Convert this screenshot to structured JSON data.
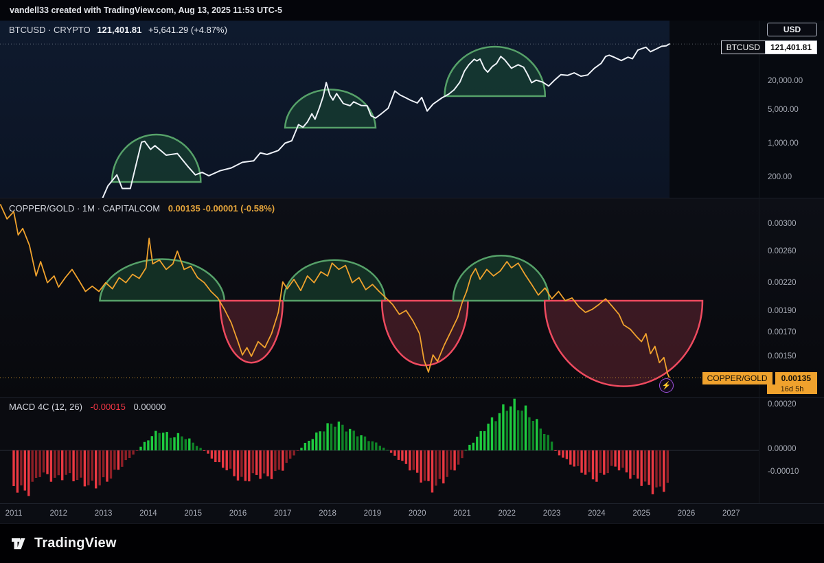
{
  "watermark": "vandell33 created with TradingView.com, Aug 13, 2025 11:53 UTC-5",
  "icons": {
    "lightning": "⚡"
  },
  "colors": {
    "accent_orange": "#f0a22d",
    "white_line": "#eef2f8",
    "dome_fill": "rgba(28,82,53,0.5)",
    "dome_stroke": "#56a169",
    "bowl_fill": "rgba(193,62,84,0.27)",
    "bowl_stroke": "#ee4a5f",
    "dotted_level": "#b5832a",
    "macd_pos_bright": "#1ecb3f",
    "macd_pos_dim": "#0f8427",
    "macd_neg_bright": "#e93842",
    "macd_neg_dim": "#8c1f26"
  },
  "btc_pane": {
    "legend_symbol": "BTCUSD · CRYPTO",
    "legend_price": "121,401.81",
    "legend_change": "+5,641.29 (+4.87%)",
    "currency_button": "USD",
    "price_label_symbol": "BTCUSD",
    "price_label_value": "121,401.81",
    "ticks": [
      {
        "v": 20000,
        "label": "20,000.00"
      },
      {
        "v": 5000,
        "label": "5,000.00"
      },
      {
        "v": 1000,
        "label": "1,000.00"
      },
      {
        "v": 200,
        "label": "200.00"
      }
    ]
  },
  "copper_pane": {
    "legend_symbol": "COPPER/GOLD · 1M · CAPITALCOM",
    "legend_values": "0.00135 -0.00001 (-0.58%)",
    "price_label_symbol": "COPPER/GOLD",
    "price_label_value": "0.00135",
    "countdown": "16d 5h",
    "ticks": [
      {
        "v": 0.003,
        "label": "0.00300"
      },
      {
        "v": 0.0026,
        "label": "0.00260"
      },
      {
        "v": 0.0022,
        "label": "0.00220"
      },
      {
        "v": 0.0019,
        "label": "0.00190"
      },
      {
        "v": 0.0017,
        "label": "0.00170"
      },
      {
        "v": 0.0015,
        "label": "0.00150"
      }
    ]
  },
  "macd_pane": {
    "legend_title": "MACD 4C (12, 26)",
    "legend_value_1": "-0.00015",
    "legend_value_2": "0.00000",
    "ticks": [
      {
        "v": 0.0002,
        "label": "0.00020"
      },
      {
        "v": 0,
        "label": "0.00000"
      },
      {
        "v": -0.0001,
        "label": "-0.00010"
      }
    ]
  },
  "time_axis": {
    "years": [
      2011,
      2012,
      2013,
      2014,
      2015,
      2016,
      2017,
      2018,
      2019,
      2020,
      2021,
      2022,
      2023,
      2024,
      2025,
      2026,
      2027
    ]
  },
  "footer": {
    "brand": "TradingView"
  },
  "chart_data": [
    {
      "type": "line",
      "name": "BTCUSD",
      "yscale": "log",
      "x_unit": "decimal_year",
      "current": 121401.81,
      "right_axis_ticks": [
        20000,
        5000,
        1000,
        200
      ],
      "points": [
        [
          2012.98,
          75
        ],
        [
          2013.1,
          135
        ],
        [
          2013.3,
          230
        ],
        [
          2013.42,
          120
        ],
        [
          2013.6,
          120
        ],
        [
          2013.85,
          1100
        ],
        [
          2013.92,
          1150
        ],
        [
          2014.05,
          780
        ],
        [
          2014.15,
          930
        ],
        [
          2014.4,
          590
        ],
        [
          2014.65,
          640
        ],
        [
          2014.9,
          330
        ],
        [
          2015.05,
          230
        ],
        [
          2015.2,
          260
        ],
        [
          2015.35,
          220
        ],
        [
          2015.6,
          280
        ],
        [
          2015.85,
          320
        ],
        [
          2016.1,
          420
        ],
        [
          2016.35,
          450
        ],
        [
          2016.5,
          660
        ],
        [
          2016.65,
          610
        ],
        [
          2016.9,
          740
        ],
        [
          2017.05,
          1050
        ],
        [
          2017.2,
          1180
        ],
        [
          2017.35,
          2550
        ],
        [
          2017.45,
          2250
        ],
        [
          2017.55,
          2900
        ],
        [
          2017.65,
          4300
        ],
        [
          2017.72,
          3300
        ],
        [
          2017.82,
          5800
        ],
        [
          2017.9,
          9800
        ],
        [
          2017.97,
          19200
        ],
        [
          2018.05,
          10500
        ],
        [
          2018.12,
          8300
        ],
        [
          2018.2,
          11300
        ],
        [
          2018.35,
          7000
        ],
        [
          2018.5,
          6300
        ],
        [
          2018.58,
          7600
        ],
        [
          2018.75,
          6400
        ],
        [
          2018.88,
          6300
        ],
        [
          2018.97,
          3900
        ],
        [
          2019.07,
          3500
        ],
        [
          2019.17,
          4100
        ],
        [
          2019.35,
          5600
        ],
        [
          2019.5,
          12800
        ],
        [
          2019.62,
          10500
        ],
        [
          2019.72,
          9500
        ],
        [
          2019.85,
          8200
        ],
        [
          2020.0,
          7200
        ],
        [
          2020.1,
          9400
        ],
        [
          2020.22,
          4900
        ],
        [
          2020.35,
          6800
        ],
        [
          2020.55,
          9200
        ],
        [
          2020.7,
          11000
        ],
        [
          2020.82,
          13500
        ],
        [
          2020.95,
          19500
        ],
        [
          2021.05,
          33000
        ],
        [
          2021.15,
          45000
        ],
        [
          2021.27,
          58500
        ],
        [
          2021.33,
          54000
        ],
        [
          2021.4,
          59000
        ],
        [
          2021.5,
          37000
        ],
        [
          2021.57,
          31500
        ],
        [
          2021.67,
          41000
        ],
        [
          2021.77,
          48000
        ],
        [
          2021.86,
          66900
        ],
        [
          2021.95,
          57000
        ],
        [
          2022.1,
          38000
        ],
        [
          2022.25,
          45000
        ],
        [
          2022.37,
          40000
        ],
        [
          2022.45,
          29500
        ],
        [
          2022.55,
          19000
        ],
        [
          2022.65,
          21500
        ],
        [
          2022.8,
          19500
        ],
        [
          2022.93,
          16200
        ],
        [
          2023.05,
          21000
        ],
        [
          2023.2,
          28000
        ],
        [
          2023.35,
          27000
        ],
        [
          2023.5,
          30500
        ],
        [
          2023.65,
          26000
        ],
        [
          2023.8,
          27500
        ],
        [
          2023.95,
          38000
        ],
        [
          2024.1,
          48000
        ],
        [
          2024.2,
          67000
        ],
        [
          2024.28,
          71000
        ],
        [
          2024.4,
          64000
        ],
        [
          2024.55,
          55000
        ],
        [
          2024.7,
          64500
        ],
        [
          2024.8,
          60000
        ],
        [
          2024.92,
          91000
        ],
        [
          2025.0,
          97000
        ],
        [
          2025.1,
          104000
        ],
        [
          2025.2,
          84000
        ],
        [
          2025.32,
          95000
        ],
        [
          2025.45,
          109000
        ],
        [
          2025.55,
          111500
        ],
        [
          2025.62,
          121401
        ]
      ],
      "arcs": [
        {
          "kind": "dome",
          "center": 2014.18,
          "radius": 0.99,
          "base": 164,
          "extreme": 1585
        },
        {
          "kind": "dome",
          "center": 2018.06,
          "radius": 1.01,
          "base": 2200,
          "extreme": 14800
        },
        {
          "kind": "dome",
          "center": 2021.73,
          "radius": 1.12,
          "base": 10000,
          "extreme": 106800
        }
      ]
    },
    {
      "type": "line",
      "name": "COPPER/GOLD 1M",
      "yscale": "log",
      "x_unit": "decimal_year",
      "current": 0.00135,
      "right_axis_ticks": [
        0.003,
        0.0026,
        0.0022,
        0.0019,
        0.0017,
        0.0015
      ],
      "points": [
        [
          2010.7,
          0.00335
        ],
        [
          2010.85,
          0.0031
        ],
        [
          2011.0,
          0.00322
        ],
        [
          2011.1,
          0.00285
        ],
        [
          2011.2,
          0.00295
        ],
        [
          2011.35,
          0.0027
        ],
        [
          2011.5,
          0.0023
        ],
        [
          2011.6,
          0.00248
        ],
        [
          2011.75,
          0.00222
        ],
        [
          2011.9,
          0.0023
        ],
        [
          2012.0,
          0.00217
        ],
        [
          2012.15,
          0.00228
        ],
        [
          2012.3,
          0.00238
        ],
        [
          2012.45,
          0.00225
        ],
        [
          2012.6,
          0.00212
        ],
        [
          2012.75,
          0.00218
        ],
        [
          2012.9,
          0.00212
        ],
        [
          2013.05,
          0.00222
        ],
        [
          2013.2,
          0.00215
        ],
        [
          2013.35,
          0.00228
        ],
        [
          2013.5,
          0.00222
        ],
        [
          2013.65,
          0.00232
        ],
        [
          2013.8,
          0.00227
        ],
        [
          2013.95,
          0.0024
        ],
        [
          2014.02,
          0.0028
        ],
        [
          2014.1,
          0.00245
        ],
        [
          2014.25,
          0.0025
        ],
        [
          2014.4,
          0.00238
        ],
        [
          2014.55,
          0.00245
        ],
        [
          2014.65,
          0.00262
        ],
        [
          2014.8,
          0.00238
        ],
        [
          2014.95,
          0.00242
        ],
        [
          2015.1,
          0.00228
        ],
        [
          2015.25,
          0.00222
        ],
        [
          2015.4,
          0.00212
        ],
        [
          2015.55,
          0.00205
        ],
        [
          2015.7,
          0.00193
        ],
        [
          2015.85,
          0.0018
        ],
        [
          2016.0,
          0.00163
        ],
        [
          2016.1,
          0.00152
        ],
        [
          2016.2,
          0.00158
        ],
        [
          2016.3,
          0.00151
        ],
        [
          2016.45,
          0.00163
        ],
        [
          2016.6,
          0.00158
        ],
        [
          2016.75,
          0.0017
        ],
        [
          2016.9,
          0.0019
        ],
        [
          2017.0,
          0.00223
        ],
        [
          2017.1,
          0.00215
        ],
        [
          2017.25,
          0.00226
        ],
        [
          2017.4,
          0.00213
        ],
        [
          2017.55,
          0.0023
        ],
        [
          2017.7,
          0.00222
        ],
        [
          2017.85,
          0.00235
        ],
        [
          2018.0,
          0.0023
        ],
        [
          2018.1,
          0.00246
        ],
        [
          2018.25,
          0.00238
        ],
        [
          2018.4,
          0.00243
        ],
        [
          2018.55,
          0.00222
        ],
        [
          2018.7,
          0.00228
        ],
        [
          2018.85,
          0.00214
        ],
        [
          2019.0,
          0.0022
        ],
        [
          2019.15,
          0.00212
        ],
        [
          2019.3,
          0.00205
        ],
        [
          2019.45,
          0.00198
        ],
        [
          2019.6,
          0.00188
        ],
        [
          2019.75,
          0.00192
        ],
        [
          2019.9,
          0.00182
        ],
        [
          2020.05,
          0.0017
        ],
        [
          2020.15,
          0.00148
        ],
        [
          2020.25,
          0.00139
        ],
        [
          2020.35,
          0.00152
        ],
        [
          2020.45,
          0.00147
        ],
        [
          2020.6,
          0.0016
        ],
        [
          2020.75,
          0.00172
        ],
        [
          2020.9,
          0.00185
        ],
        [
          2021.0,
          0.002
        ],
        [
          2021.1,
          0.00212
        ],
        [
          2021.2,
          0.0023
        ],
        [
          2021.3,
          0.00239
        ],
        [
          2021.4,
          0.00226
        ],
        [
          2021.55,
          0.00238
        ],
        [
          2021.7,
          0.0023
        ],
        [
          2021.85,
          0.00236
        ],
        [
          2022.0,
          0.00248
        ],
        [
          2022.1,
          0.0024
        ],
        [
          2022.25,
          0.00246
        ],
        [
          2022.4,
          0.00232
        ],
        [
          2022.55,
          0.0022
        ],
        [
          2022.7,
          0.00208
        ],
        [
          2022.85,
          0.00216
        ],
        [
          2023.0,
          0.00204
        ],
        [
          2023.15,
          0.00212
        ],
        [
          2023.3,
          0.00202
        ],
        [
          2023.45,
          0.00205
        ],
        [
          2023.6,
          0.00196
        ],
        [
          2023.75,
          0.0019
        ],
        [
          2023.9,
          0.00193
        ],
        [
          2024.05,
          0.00198
        ],
        [
          2024.2,
          0.00204
        ],
        [
          2024.35,
          0.00196
        ],
        [
          2024.5,
          0.00188
        ],
        [
          2024.6,
          0.00178
        ],
        [
          2024.75,
          0.00174
        ],
        [
          2024.9,
          0.00167
        ],
        [
          2025.0,
          0.00163
        ],
        [
          2025.1,
          0.0017
        ],
        [
          2025.2,
          0.00153
        ],
        [
          2025.3,
          0.00159
        ],
        [
          2025.4,
          0.00146
        ],
        [
          2025.5,
          0.0015
        ],
        [
          2025.58,
          0.00138
        ],
        [
          2025.62,
          0.00135
        ]
      ],
      "arcs": [
        {
          "kind": "dome",
          "center": 2014.31,
          "radius": 1.39,
          "base": 0.00202,
          "extreme": 0.00253
        },
        {
          "kind": "bowl",
          "center": 2016.3,
          "radius": 0.7,
          "base": 0.00202,
          "extreme": 0.00146
        },
        {
          "kind": "dome",
          "center": 2018.15,
          "radius": 1.13,
          "base": 0.00202,
          "extreme": 0.0025
        },
        {
          "kind": "bowl",
          "center": 2020.17,
          "radius": 0.96,
          "base": 0.00202,
          "extreme": 0.00144
        },
        {
          "kind": "dome",
          "center": 2021.87,
          "radius": 1.07,
          "base": 0.00202,
          "extreme": 0.00256
        },
        {
          "kind": "bowl",
          "center": 2024.6,
          "radius": 1.76,
          "base": 0.00202,
          "extreme": 0.00129
        }
      ]
    },
    {
      "type": "bar",
      "name": "MACD 4C (12, 26)",
      "x_unit": "decimal_year",
      "bar_step_years": 0.0833,
      "current": -0.00015,
      "right_axis_ticks": [
        0.0002,
        0,
        -0.0001
      ],
      "x": [
        2011.0,
        2011.3,
        2011.6,
        2011.9,
        2012.2,
        2012.5,
        2012.8,
        2013.1,
        2013.4,
        2013.7,
        2013.9,
        2014.1,
        2014.3,
        2014.5,
        2014.7,
        2014.9,
        2015.1,
        2015.3,
        2015.5,
        2015.8,
        2016.1,
        2016.4,
        2016.7,
        2017.0,
        2017.25,
        2017.5,
        2017.8,
        2018.0,
        2018.2,
        2018.4,
        2018.6,
        2018.8,
        2019.0,
        2019.2,
        2019.4,
        2019.6,
        2019.9,
        2020.1,
        2020.35,
        2020.6,
        2020.8,
        2021.0,
        2021.1,
        2021.3,
        2021.5,
        2021.8,
        2022.0,
        2022.2,
        2022.4,
        2022.6,
        2022.8,
        2023.0,
        2023.1,
        2023.3,
        2023.5,
        2023.8,
        2024.0,
        2024.2,
        2024.4,
        2024.6,
        2024.8,
        2025.0,
        2025.2,
        2025.4,
        2025.58
      ],
      "values": [
        -0.00016,
        -0.00019,
        -0.0001,
        -0.00013,
        -0.00011,
        -0.00014,
        -0.00016,
        -0.00013,
        -7e-05,
        -1e-05,
        3e-05,
        7e-05,
        9e-05,
        6e-05,
        7e-05,
        5e-05,
        2e-05,
        -1e-05,
        -5e-05,
        -9e-05,
        -0.00014,
        -0.00011,
        -0.00012,
        -8e-05,
        -2e-05,
        3e-05,
        8e-05,
        0.00011,
        0.000125,
        0.0001,
        8e-05,
        6e-05,
        4e-05,
        2e-05,
        -1e-05,
        -4e-05,
        -9e-05,
        -0.00013,
        -0.00017,
        -0.00013,
        -9e-05,
        -4e-05,
        1e-05,
        5e-05,
        0.0001,
        0.00016,
        0.0002,
        0.000205,
        0.00018,
        0.00014,
        9e-05,
        4e-05,
        -1e-05,
        -4e-05,
        -7e-05,
        -0.00011,
        -0.00013,
        -0.0001,
        -7e-05,
        -9e-05,
        -0.00012,
        -0.00014,
        -0.00017,
        -0.00018,
        -0.00015
      ]
    }
  ]
}
